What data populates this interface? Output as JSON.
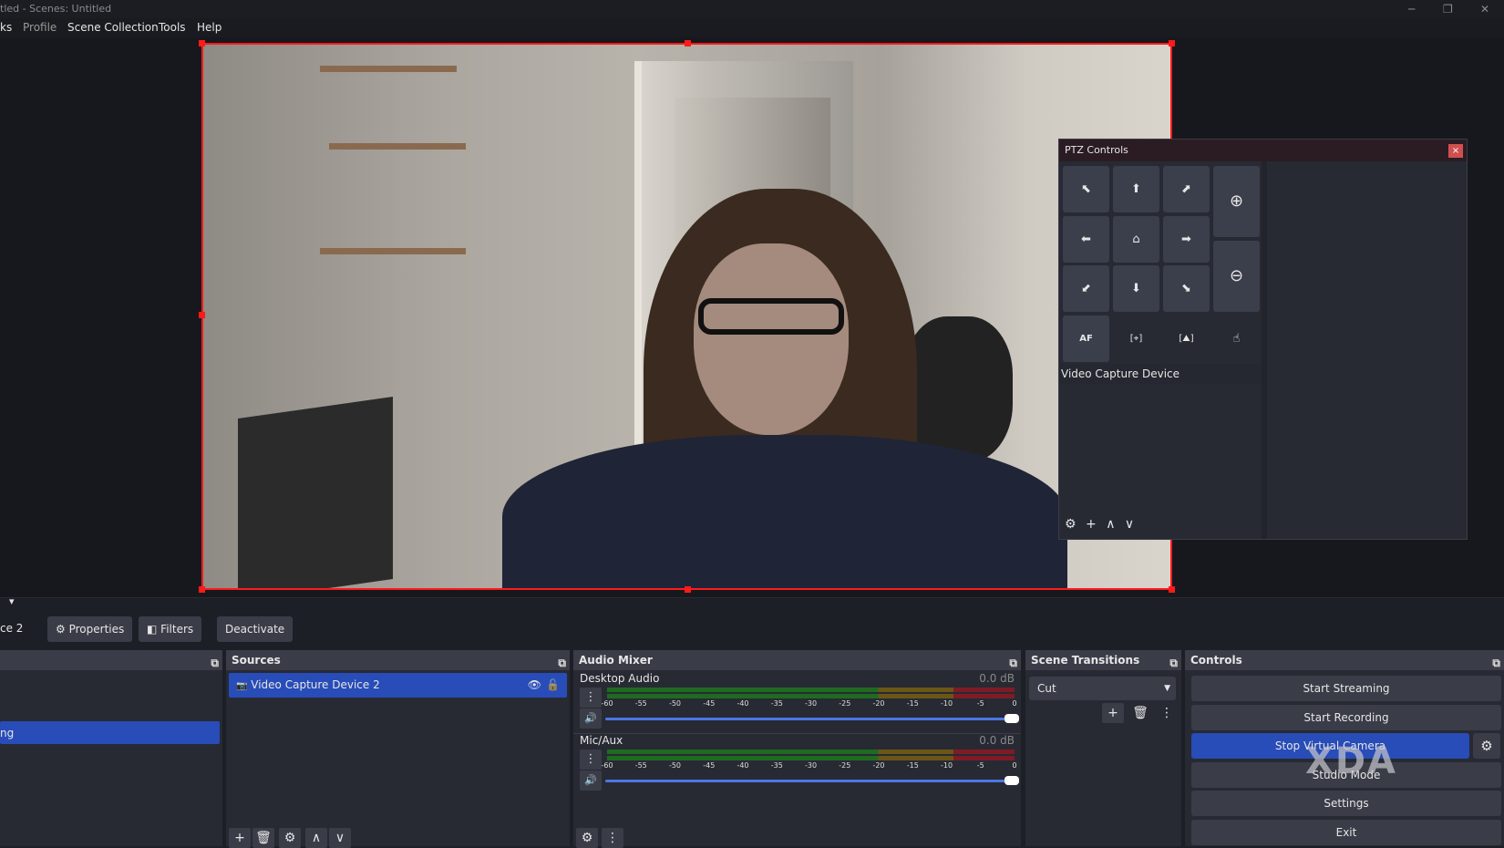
{
  "window": {
    "title": "tled - Scenes: Untitled",
    "min": "─",
    "max": "❐",
    "close": "✕"
  },
  "menu": [
    "ks",
    "Profile",
    "Scene Collection",
    "Tools",
    "Help"
  ],
  "ptz": {
    "title": "PTZ Controls",
    "close": "×",
    "device": "Video Capture Device",
    "buttons": {
      "up_left": "⬉",
      "up": "⬆",
      "up_right": "⬈",
      "left": "⬅",
      "home": "⌂",
      "right": "➡",
      "down_left": "⬋",
      "down": "⬇",
      "down_right": "⬊",
      "zoom_in": "⊕",
      "zoom_out": "⊖",
      "autofocus": "AF",
      "focus_one_touch": "[⌖]",
      "focus_manual": "[⛰]",
      "touch": "☝"
    },
    "footer": {
      "settings": "⚙",
      "add": "+",
      "up": "∧",
      "down": "∨"
    }
  },
  "toolbar": {
    "source_name": "ce 2",
    "properties": "Properties",
    "filters": "Filters",
    "deactivate": "Deactivate",
    "properties_icon": "⚙",
    "filters_icon": "◧",
    "collapse": "▾"
  },
  "scenes": {
    "selected": "ng"
  },
  "sources": {
    "title": "Sources",
    "items": [
      {
        "name": "Video Capture Device 2",
        "icon": "📷",
        "visible": "👁",
        "lock": "🔓"
      }
    ],
    "add": "+",
    "remove": "🗑",
    "settings": "⚙",
    "up": "∧",
    "down": "∨"
  },
  "audio": {
    "title": "Audio Mixer",
    "scale": [
      "-60",
      "-55",
      "-50",
      "-45",
      "-40",
      "-35",
      "-30",
      "-25",
      "-20",
      "-15",
      "-10",
      "-5",
      "0"
    ],
    "channels": [
      {
        "name": "Desktop Audio",
        "db": "0.0 dB",
        "volume": 1.0
      },
      {
        "name": "Mic/Aux",
        "db": "0.0 dB",
        "volume": 1.0
      }
    ],
    "menu": "⋮",
    "speaker": "🔊",
    "advanced": "⚙"
  },
  "transitions": {
    "title": "Scene Transitions",
    "selected": "Cut",
    "add": "+",
    "remove": "🗑",
    "menu": "⋮"
  },
  "controls": {
    "title": "Controls",
    "start_streaming": "Start Streaming",
    "start_recording": "Start Recording",
    "stop_virtual_camera": "Stop Virtual Camera",
    "studio_mode": "Studio Mode",
    "settings": "Settings",
    "exit": "Exit",
    "vcam_settings": "⚙"
  },
  "watermark": "XDA",
  "colors": {
    "accent": "#284cb8",
    "selection_border": "#ff1a1a",
    "panel": "#272a33"
  }
}
